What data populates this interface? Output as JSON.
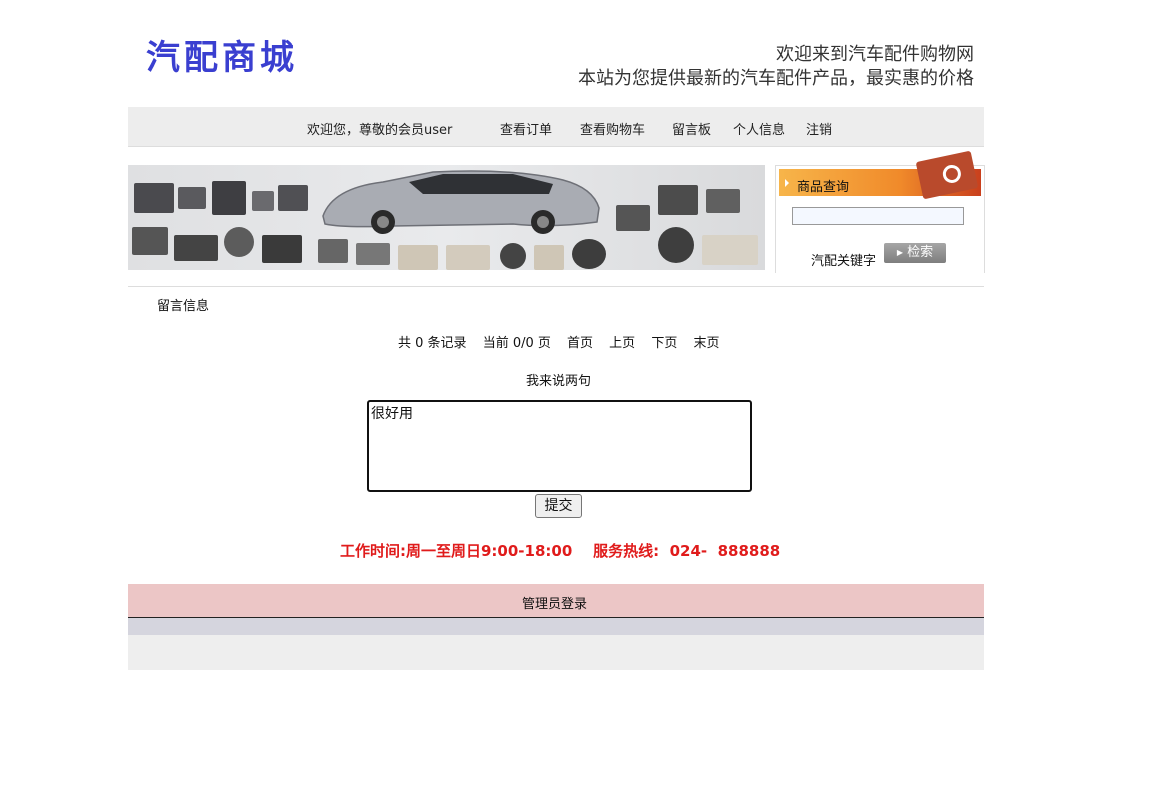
{
  "header": {
    "logo_text": "汽配商城",
    "welcome_line1": "欢迎来到汽车配件购物网",
    "welcome_line2": "本站为您提供最新的汽车配件产品，最实惠的价格"
  },
  "nav": {
    "greeting": "欢迎您，尊敬的会员user",
    "items": [
      {
        "label": "查看订单"
      },
      {
        "label": "查看购物车"
      },
      {
        "label": "留言板"
      },
      {
        "label": "个人信息"
      },
      {
        "label": "注销"
      }
    ]
  },
  "search": {
    "title": "商品查询",
    "input_value": "",
    "keyword_label": "汽配关键字",
    "button_label": "检索"
  },
  "messages": {
    "title": "留言信息",
    "pager": {
      "total": "共 0 条记录",
      "current": "当前 0/0 页",
      "first": "首页",
      "prev": "上页",
      "next": "下页",
      "last": "末页"
    },
    "compose_label": "我来说两句",
    "compose_value": "很好用",
    "submit_label": "提交"
  },
  "footer": {
    "worktime": "工作时间:周一至周日9:00-18:00    服务热线:  024-  888888",
    "admin_login": "管理员登录"
  },
  "colors": {
    "logo": "#3a3fd0",
    "hotline": "#e01b1b",
    "footer_pink": "#ecc6c6",
    "nav_bg": "#ededed"
  }
}
